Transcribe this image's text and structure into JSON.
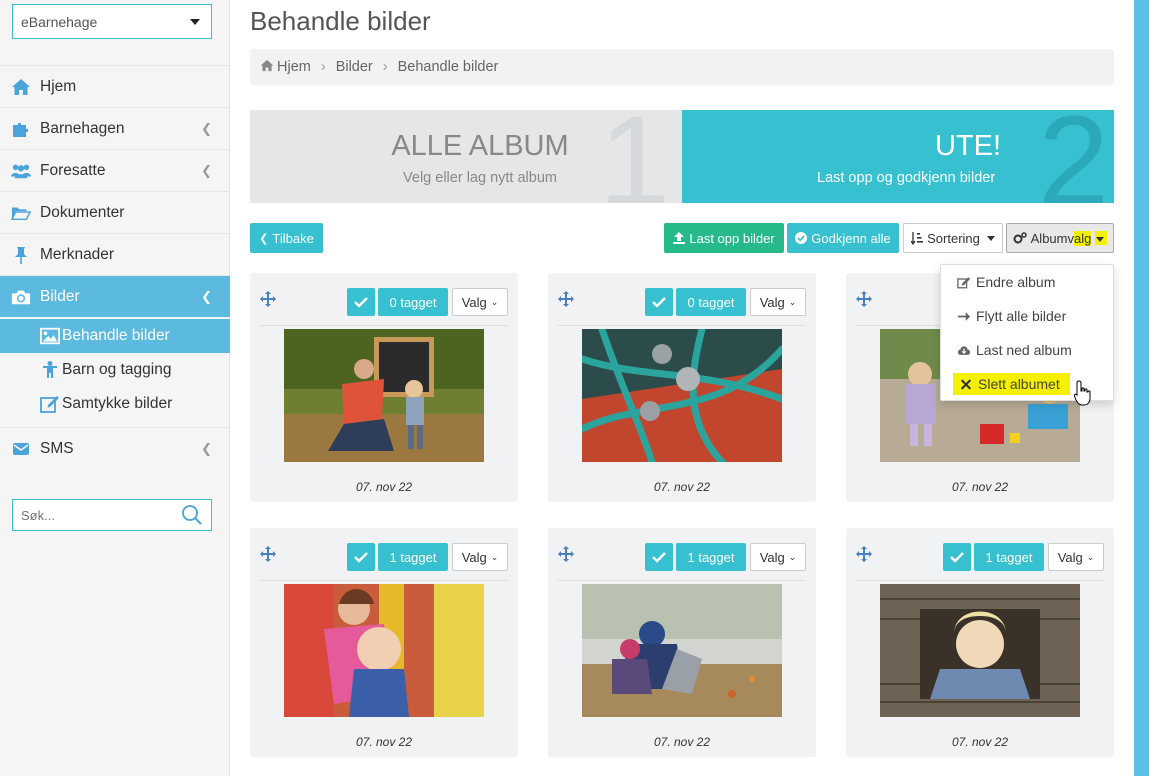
{
  "sidebar": {
    "brand_select": "eBarnehage",
    "nav": [
      {
        "label": "Hjem",
        "icon": "home-icon"
      },
      {
        "label": "Barnehagen",
        "icon": "puzzle-icon"
      },
      {
        "label": "Foresatte",
        "icon": "users-icon"
      },
      {
        "label": "Dokumenter",
        "icon": "folder-icon"
      },
      {
        "label": "Merknader",
        "icon": "pin-icon"
      },
      {
        "label": "Bilder",
        "icon": "camera-icon"
      },
      {
        "label": "SMS",
        "icon": "envelope-icon"
      }
    ],
    "subnav": [
      {
        "label": "Behandle bilder",
        "icon": "image-icon"
      },
      {
        "label": "Barn og tagging",
        "icon": "child-icon"
      },
      {
        "label": "Samtykke bilder",
        "icon": "edit-icon"
      }
    ],
    "search_placeholder": "Søk..."
  },
  "page": {
    "title": "Behandle bilder",
    "breadcrumb": [
      "Hjem",
      "Bilder",
      "Behandle bilder"
    ]
  },
  "steps": [
    {
      "number": "1",
      "title": "ALLE ALBUM",
      "subtitle": "Velg eller lag nytt album"
    },
    {
      "number": "2",
      "title": "UTE!",
      "subtitle": "Last opp og godkjenn bilder"
    }
  ],
  "toolbar": {
    "back": "Tilbake",
    "upload": "Last opp bilder",
    "approve_all": "Godkjenn alle",
    "sort": "Sortering",
    "album_options_a": "Albumv",
    "album_options_b": "alg"
  },
  "album_menu": {
    "edit": "Endre album",
    "move_all": "Flytt alle bilder",
    "download": "Last ned album",
    "delete": "Slett albumet"
  },
  "photos": [
    {
      "tagged": "0 tagget",
      "options": "Valg",
      "date": "07. nov 22"
    },
    {
      "tagged": "0 tagget",
      "options": "Valg",
      "date": "07. nov 22"
    },
    {
      "tagged": "",
      "options": "",
      "date": "07. nov 22"
    },
    {
      "tagged": "1 tagget",
      "options": "Valg",
      "date": "07. nov 22"
    },
    {
      "tagged": "1 tagget",
      "options": "Valg",
      "date": "07. nov 22"
    },
    {
      "tagged": "1 tagget",
      "options": "Valg",
      "date": "07. nov 22"
    }
  ],
  "colors": {
    "accent": "#36c0d0",
    "sidebar_active": "#5cb9e0",
    "green": "#26b98a",
    "highlight": "#f5f000"
  }
}
